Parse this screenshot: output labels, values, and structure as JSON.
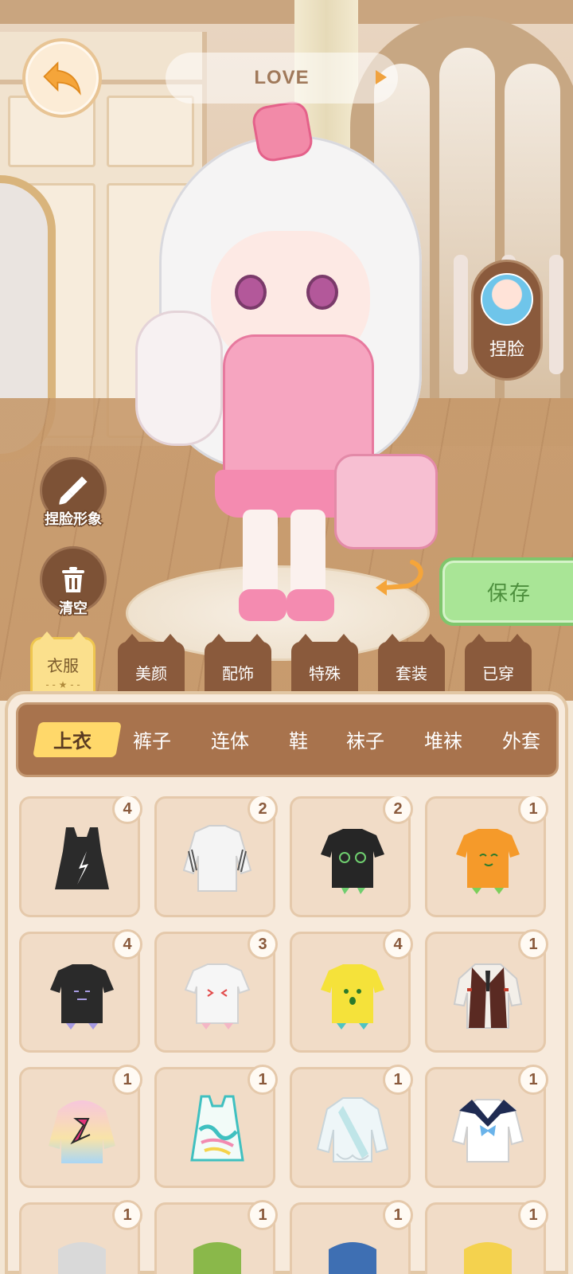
{
  "header": {
    "music_title": "LOVE"
  },
  "face_button": {
    "label": "捏脸"
  },
  "side_buttons": {
    "face_image_label": "捏脸形象",
    "clear_label": "清空"
  },
  "save_button": {
    "label": "保存"
  },
  "category_tabs": [
    {
      "label": "衣服",
      "active": true
    },
    {
      "label": "美颜",
      "active": false
    },
    {
      "label": "配饰",
      "active": false
    },
    {
      "label": "特殊",
      "active": false
    },
    {
      "label": "套装",
      "active": false
    },
    {
      "label": "已穿",
      "active": false
    }
  ],
  "sub_tabs": [
    {
      "label": "上衣",
      "active": true
    },
    {
      "label": "裤子",
      "active": false
    },
    {
      "label": "连体",
      "active": false
    },
    {
      "label": "鞋",
      "active": false
    },
    {
      "label": "袜子",
      "active": false
    },
    {
      "label": "堆袜",
      "active": false
    },
    {
      "label": "外套",
      "active": false
    }
  ],
  "items": [
    {
      "count": "4",
      "icon": "black-tanktop-icon",
      "color": "#2b2b2b"
    },
    {
      "count": "2",
      "icon": "white-striped-shirt-icon",
      "color": "#f4f4f4"
    },
    {
      "count": "2",
      "icon": "black-swirl-tee-icon",
      "color": "#262626"
    },
    {
      "count": "1",
      "icon": "orange-smile-tee-icon",
      "color": "#f59a2a"
    },
    {
      "count": "4",
      "icon": "black-face-tee-icon",
      "color": "#2a2a2a"
    },
    {
      "count": "3",
      "icon": "white-face-tee-icon",
      "color": "#f6f6f6"
    },
    {
      "count": "4",
      "icon": "yellow-face-tee-icon",
      "color": "#f5e23a"
    },
    {
      "count": "1",
      "icon": "red-vest-uniform-icon",
      "color": "#5a2a22"
    },
    {
      "count": "1",
      "icon": "pastel-hoodie-icon",
      "color": "#f7c6dc"
    },
    {
      "count": "1",
      "icon": "graffiti-tanktop-icon",
      "color": "#f2fbf8"
    },
    {
      "count": "1",
      "icon": "white-frill-blouse-icon",
      "color": "#eef6f8"
    },
    {
      "count": "1",
      "icon": "sailor-top-icon",
      "color": "#ffffff"
    },
    {
      "count": "1",
      "icon": "gray-top-icon",
      "color": "#d9d9d9"
    },
    {
      "count": "1",
      "icon": "green-knit-top-icon",
      "color": "#8ab84a"
    },
    {
      "count": "1",
      "icon": "blue-top-icon",
      "color": "#3e6fb3"
    },
    {
      "count": "1",
      "icon": "yellow-top-icon",
      "color": "#f4d24e"
    }
  ],
  "colors": {
    "brown": "#8a5a3c",
    "panel": "#f7eadc",
    "save_green": "#a9e596",
    "active_tab": "#fbe08d",
    "subtab_highlight": "#ffd86a"
  }
}
